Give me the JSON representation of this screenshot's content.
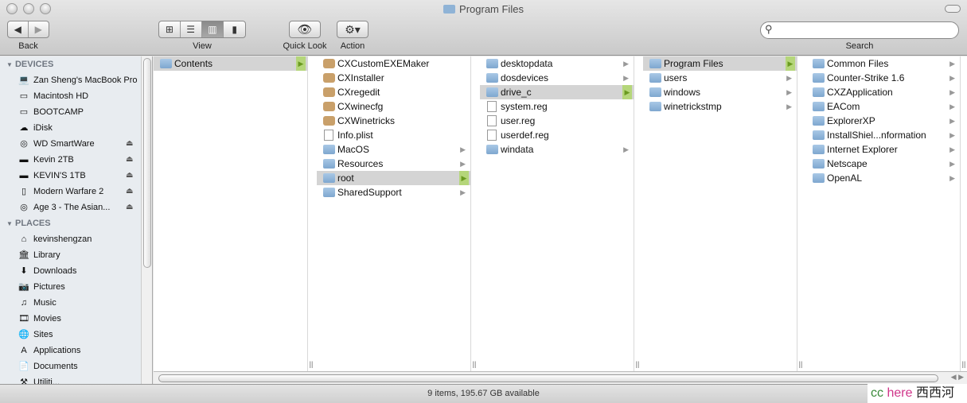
{
  "window": {
    "title": "Program Files"
  },
  "toolbar": {
    "back": "Back",
    "view": "View",
    "quick_look": "Quick Look",
    "action": "Action",
    "search": "Search",
    "search_value": ""
  },
  "sidebar": {
    "devices_label": "DEVICES",
    "devices": [
      {
        "label": "Zan Sheng's MacBook Pro",
        "icon": "laptop-icon",
        "eject": false
      },
      {
        "label": "Macintosh HD",
        "icon": "hard-drive-icon",
        "eject": false
      },
      {
        "label": "BOOTCAMP",
        "icon": "hard-drive-icon",
        "eject": false
      },
      {
        "label": "iDisk",
        "icon": "idisk-icon",
        "eject": false
      },
      {
        "label": "WD SmartWare",
        "icon": "cd-icon",
        "eject": true
      },
      {
        "label": "Kevin 2TB",
        "icon": "external-drive-icon",
        "eject": true
      },
      {
        "label": "KEVIN'S 1TB",
        "icon": "external-drive-icon",
        "eject": true
      },
      {
        "label": "Modern Warfare 2",
        "icon": "disk-image-icon",
        "eject": true
      },
      {
        "label": "Age 3 - The Asian...",
        "icon": "cd-icon",
        "eject": true
      }
    ],
    "places_label": "PLACES",
    "places": [
      {
        "label": "kevinshengzan",
        "icon": "home-icon"
      },
      {
        "label": "Library",
        "icon": "library-icon"
      },
      {
        "label": "Downloads",
        "icon": "downloads-icon"
      },
      {
        "label": "Pictures",
        "icon": "pictures-icon"
      },
      {
        "label": "Music",
        "icon": "music-icon"
      },
      {
        "label": "Movies",
        "icon": "movies-icon"
      },
      {
        "label": "Sites",
        "icon": "sites-icon"
      },
      {
        "label": "Applications",
        "icon": "applications-icon"
      },
      {
        "label": "Documents",
        "icon": "documents-icon"
      },
      {
        "label": "Utiliti...",
        "icon": "utilities-icon"
      }
    ]
  },
  "columns": [
    [
      {
        "label": "Contents",
        "type": "folder",
        "arrow": true,
        "selected": true
      }
    ],
    [
      {
        "label": "CXCustomEXEMaker",
        "type": "app"
      },
      {
        "label": "CXInstaller",
        "type": "app"
      },
      {
        "label": "CXregedit",
        "type": "app"
      },
      {
        "label": "CXwinecfg",
        "type": "app"
      },
      {
        "label": "CXWinetricks",
        "type": "app"
      },
      {
        "label": "Info.plist",
        "type": "doc"
      },
      {
        "label": "MacOS",
        "type": "folder",
        "arrow": true
      },
      {
        "label": "Resources",
        "type": "folder",
        "arrow": true
      },
      {
        "label": "root",
        "type": "folder",
        "arrow": true,
        "selected": true
      },
      {
        "label": "SharedSupport",
        "type": "folder",
        "arrow": true
      }
    ],
    [
      {
        "label": "desktopdata",
        "type": "folder",
        "arrow": true
      },
      {
        "label": "dosdevices",
        "type": "folder",
        "arrow": true
      },
      {
        "label": "drive_c",
        "type": "folder",
        "arrow": true,
        "selected": true
      },
      {
        "label": "system.reg",
        "type": "doc"
      },
      {
        "label": "user.reg",
        "type": "doc"
      },
      {
        "label": "userdef.reg",
        "type": "doc"
      },
      {
        "label": "windata",
        "type": "folder",
        "arrow": true
      }
    ],
    [
      {
        "label": "Program Files",
        "type": "folder",
        "arrow": true,
        "selected": true
      },
      {
        "label": "users",
        "type": "folder",
        "arrow": true
      },
      {
        "label": "windows",
        "type": "folder",
        "arrow": true
      },
      {
        "label": "winetrickstmp",
        "type": "folder",
        "arrow": true
      }
    ],
    [
      {
        "label": "Common Files",
        "type": "folder",
        "arrow": true
      },
      {
        "label": "Counter-Strike 1.6",
        "type": "folder",
        "arrow": true
      },
      {
        "label": "CXZApplication",
        "type": "folder",
        "arrow": true
      },
      {
        "label": "EACom",
        "type": "folder",
        "arrow": true
      },
      {
        "label": "ExplorerXP",
        "type": "folder",
        "arrow": true
      },
      {
        "label": "InstallShiel...nformation",
        "type": "folder",
        "arrow": true
      },
      {
        "label": "Internet Explorer",
        "type": "folder",
        "arrow": true
      },
      {
        "label": "Netscape",
        "type": "folder",
        "arrow": true
      },
      {
        "label": "OpenAL",
        "type": "folder",
        "arrow": true
      }
    ]
  ],
  "status": {
    "text": "9 items, 195.67 GB available"
  },
  "watermark": {
    "cc": "cc",
    "here": "here",
    "cn": "西西河"
  }
}
